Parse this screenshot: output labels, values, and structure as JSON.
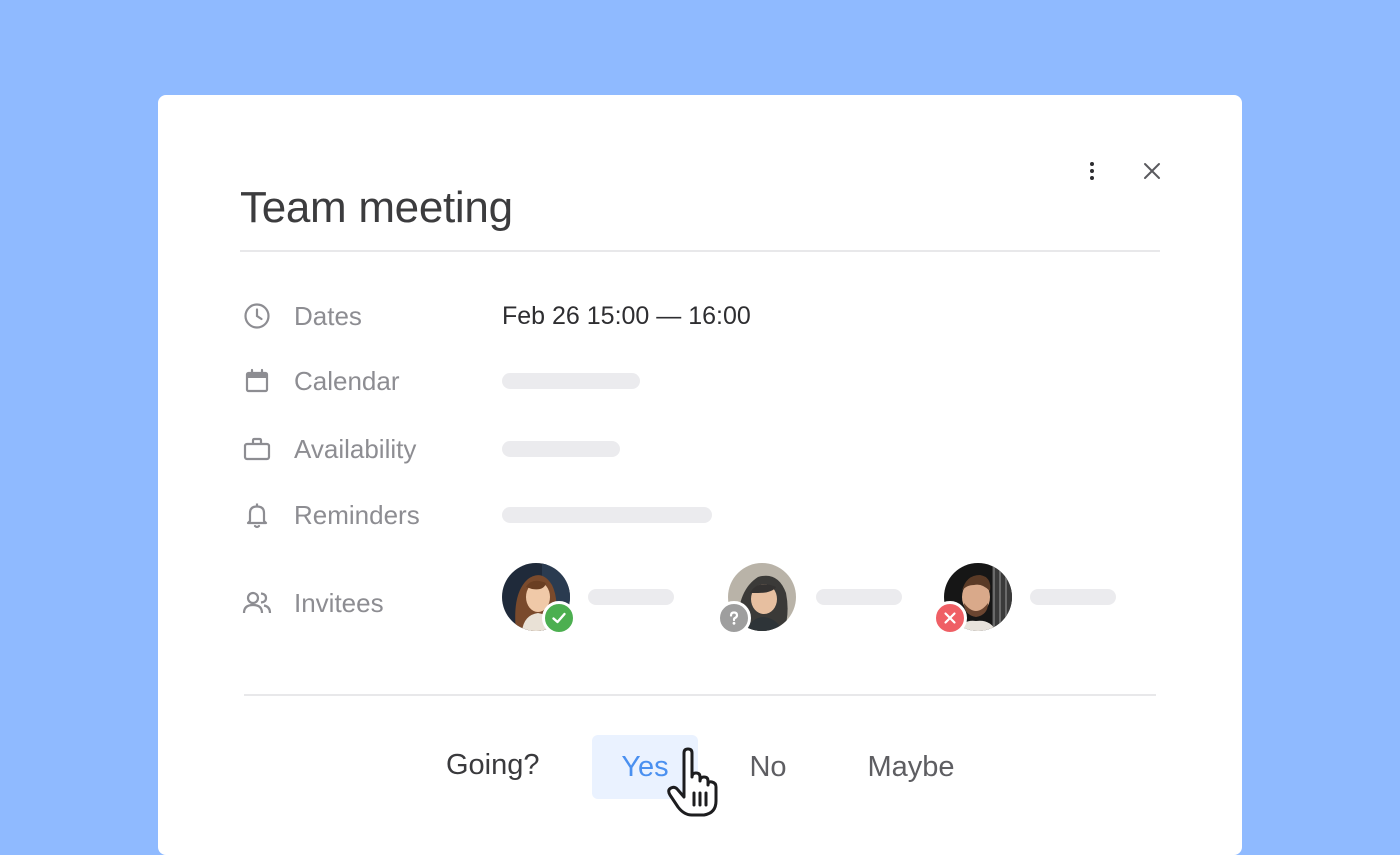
{
  "event": {
    "title": "Team meeting"
  },
  "toolbar": {
    "more_icon": "more-vertical-icon",
    "close_icon": "close-icon"
  },
  "details": [
    {
      "icon": "clock-icon",
      "label": "Dates",
      "value": "Feb 26 15:00 — 16:00"
    },
    {
      "icon": "calendar-icon",
      "label": "Calendar",
      "value": ""
    },
    {
      "icon": "briefcase-icon",
      "label": "Availability",
      "value": ""
    },
    {
      "icon": "bell-icon",
      "label": "Reminders",
      "value": ""
    },
    {
      "icon": "people-icon",
      "label": "Invitees",
      "value": ""
    }
  ],
  "invitees": [
    {
      "status": "accepted",
      "status_icon": "check-icon",
      "status_color": "#4caf50"
    },
    {
      "status": "unknown",
      "status_icon": "question-icon",
      "status_color": "#9e9e9e"
    },
    {
      "status": "declined",
      "status_icon": "x-icon",
      "status_color": "#ef5f65"
    }
  ],
  "rsvp": {
    "prompt": "Going?",
    "options": [
      "Yes",
      "No",
      "Maybe"
    ],
    "selected": "Yes"
  },
  "colors": {
    "background": "#8fbaff",
    "accent": "#4a90f0",
    "selected_bg": "#eaf2ff"
  }
}
